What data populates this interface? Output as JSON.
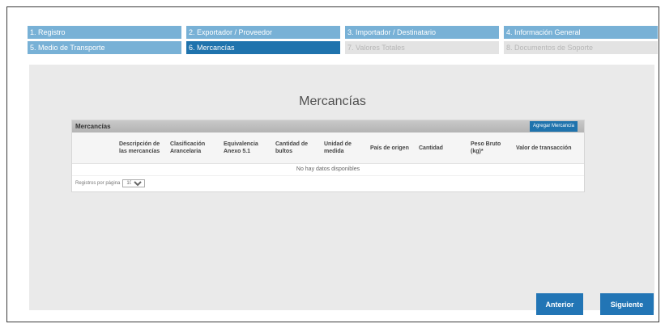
{
  "steps": [
    {
      "label": "1. Registro",
      "state": "done"
    },
    {
      "label": "2. Exportador / Proveedor",
      "state": "done"
    },
    {
      "label": "3. Importador / Destinatario",
      "state": "done"
    },
    {
      "label": "4. Información General",
      "state": "done"
    },
    {
      "label": "5. Medio de Transporte",
      "state": "done"
    },
    {
      "label": "6. Mercancías",
      "state": "active"
    },
    {
      "label": "7. Valores Totales",
      "state": "pending"
    },
    {
      "label": "8. Documentos de Soporte",
      "state": "pending"
    }
  ],
  "main": {
    "title": "Mercancías"
  },
  "table": {
    "title": "Mercancías",
    "add_label": "Agregar Mercancía",
    "columns": [
      "",
      "Descripción de las mercancías",
      "Clasificación Arancelaria",
      "Equivalencia Anexo 5.1",
      "Cantidad de bultos",
      "Unidad de medida",
      "País de origen",
      "Cantidad",
      "Peso Bruto (kg)*",
      "Valor de transacción"
    ],
    "empty_text": "No hay datos disponibles",
    "pager_label": "Registros por página",
    "page_size": "10"
  },
  "buttons": {
    "previous": "Anterior",
    "next": "Siguiente"
  }
}
